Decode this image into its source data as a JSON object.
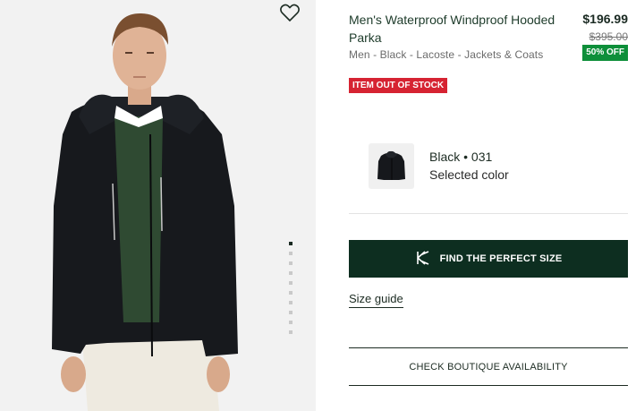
{
  "product": {
    "title": "Men's Waterproof Windproof Hooded Parka",
    "breadcrumb": "Men - Black - Lacoste - Jackets & Coats",
    "price": "$196.99",
    "old_price": "$395.00",
    "discount": "50% OFF",
    "stock_badge": "ITEM OUT OF STOCK"
  },
  "color": {
    "name": "Black • 031",
    "sub_label": "Selected color"
  },
  "buttons": {
    "find_size": "FIND THE PERFECT SIZE",
    "size_guide": "Size guide",
    "boutique": "CHECK BOUTIQUE AVAILABILITY"
  },
  "gallery": {
    "image_count": 10,
    "active_index": 0
  },
  "colors": {
    "brand_dark": "#0d2e20",
    "discount_green": "#0e8f3a",
    "out_of_stock_red": "#d62332"
  }
}
